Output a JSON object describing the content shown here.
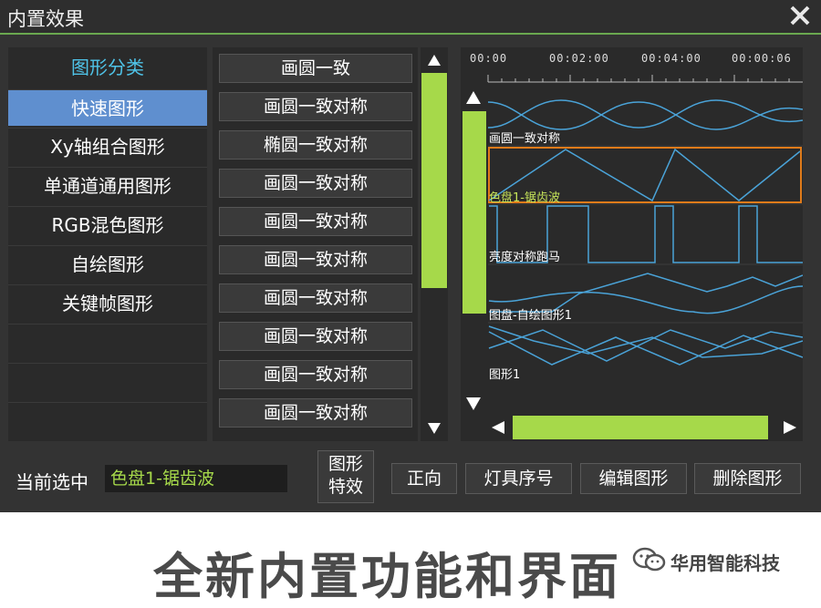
{
  "window": {
    "title": "内置效果"
  },
  "categories": {
    "header": "图形分类",
    "items": [
      {
        "label": "快速图形",
        "active": true
      },
      {
        "label": "Xy轴组合图形"
      },
      {
        "label": "单通道通用图形"
      },
      {
        "label": "RGB混色图形"
      },
      {
        "label": "自绘图形"
      },
      {
        "label": "关键帧图形"
      }
    ]
  },
  "effects": [
    "画圆一致",
    "画圆一致对称",
    "椭圆一致对称",
    "画圆一致对称",
    "画圆一致对称",
    "画圆一致对称",
    "画圆一致对称",
    "画圆一致对称",
    "画圆一致对称",
    "画圆一致对称"
  ],
  "timeline": {
    "ticks": [
      "00:00",
      "00:02:00",
      "00:04:00",
      "00:00:06"
    ],
    "tracks": [
      {
        "label": "画圆一致对称"
      },
      {
        "label": "色盘1-锯齿波",
        "selected": true
      },
      {
        "label": "亮度对称跑马"
      },
      {
        "label": "图盘-自绘图形1"
      },
      {
        "label": "图形1"
      }
    ]
  },
  "footer": {
    "current_label": "当前选中",
    "current_value": "色盘1-锯齿波",
    "effect_line1": "图形",
    "effect_line2": "特效",
    "forward": "正向",
    "fixture_order": "灯具序号",
    "edit_shape": "编辑图形",
    "delete_shape": "删除图形"
  },
  "banner": "全新内置功能和界面",
  "watermark": "华用智能科技",
  "colors": {
    "accent_green": "#a6d94a",
    "selected_blue": "#5f8fcf",
    "header_cyan": "#4fc3e8",
    "wave_blue": "#4aa3d8",
    "selection_orange": "#e07b1a"
  }
}
